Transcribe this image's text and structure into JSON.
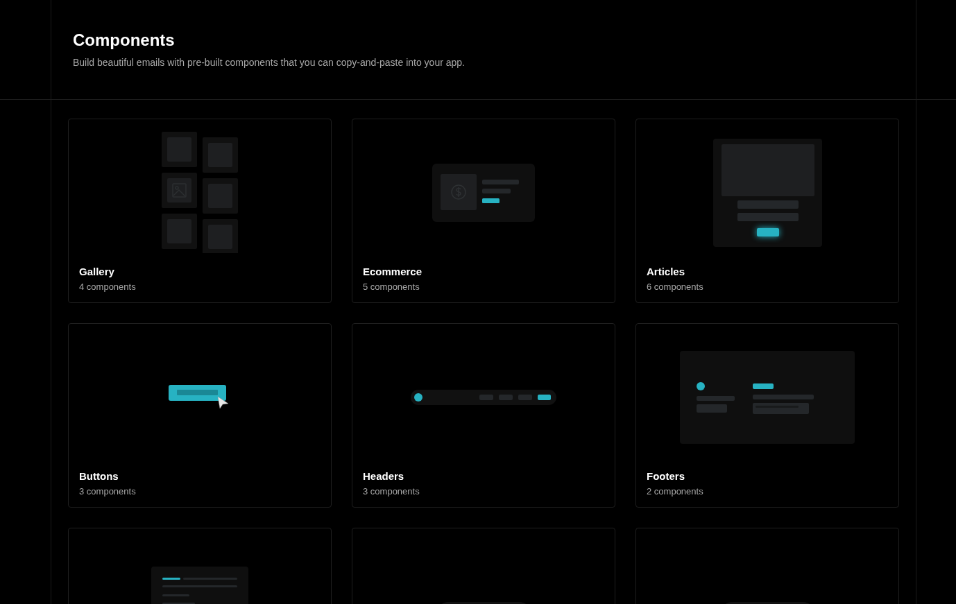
{
  "header": {
    "title": "Components",
    "subtitle": "Build beautiful emails with pre-built components that you can copy-and-paste into your app."
  },
  "cards": [
    {
      "kind": "gallery",
      "title": "Gallery",
      "count": "4 components"
    },
    {
      "kind": "ecommerce",
      "title": "Ecommerce",
      "count": "5 components"
    },
    {
      "kind": "articles",
      "title": "Articles",
      "count": "6 components"
    },
    {
      "kind": "buttons",
      "title": "Buttons",
      "count": "3 components"
    },
    {
      "kind": "headers",
      "title": "Headers",
      "count": "3 components"
    },
    {
      "kind": "footers",
      "title": "Footers",
      "count": "2 components"
    },
    {
      "kind": "text"
    },
    {
      "kind": "steps"
    },
    {
      "kind": "divider"
    }
  ]
}
